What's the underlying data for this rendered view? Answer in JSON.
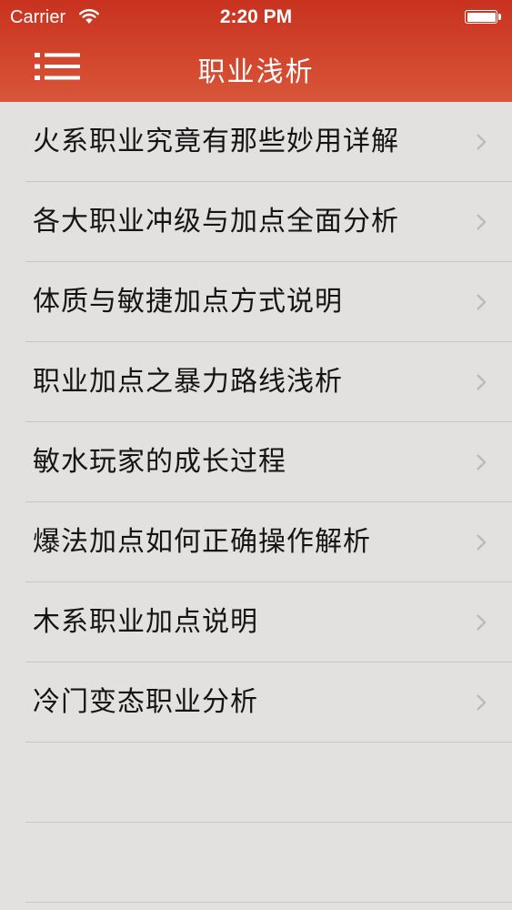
{
  "status_bar": {
    "carrier": "Carrier",
    "time": "2:20 PM",
    "wifi_icon": "wifi-icon",
    "battery_icon": "battery-full-icon"
  },
  "nav": {
    "title": "职业浅析",
    "menu_icon": "hamburger-menu-icon"
  },
  "colors": {
    "nav_bar": "#cf4229",
    "background": "#e3e1e0",
    "separator": "#c9c6c4",
    "text": "#141414",
    "chevron": "#bdbbb9"
  },
  "list": {
    "items": [
      {
        "label": "火系职业究竟有那些妙用详解"
      },
      {
        "label": "各大职业冲级与加点全面分析"
      },
      {
        "label": "体质与敏捷加点方式说明"
      },
      {
        "label": "职业加点之暴力路线浅析"
      },
      {
        "label": "敏水玩家的成长过程"
      },
      {
        "label": "爆法加点如何正确操作解析"
      },
      {
        "label": "木系职业加点说明"
      },
      {
        "label": "冷门变态职业分析"
      }
    ]
  }
}
